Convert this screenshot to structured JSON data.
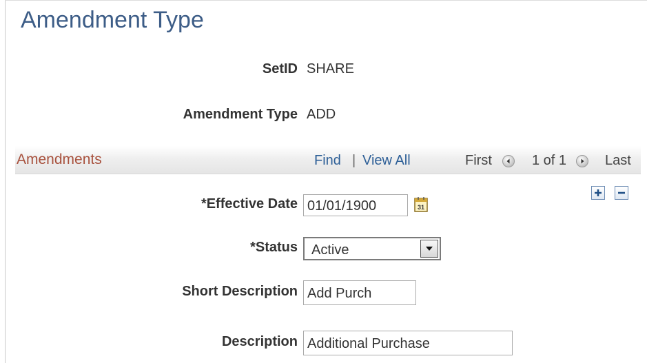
{
  "page": {
    "title": "Amendment Type"
  },
  "header": {
    "setid_label": "SetID",
    "setid_value": "SHARE",
    "amendment_type_label": "Amendment Type",
    "amendment_type_value": "ADD"
  },
  "grid": {
    "title": "Amendments",
    "find_label": "Find",
    "separator": "|",
    "view_all_label": "View All",
    "first_label": "First",
    "range_label": "1 of 1",
    "last_label": "Last"
  },
  "form": {
    "effective_date_label": "*Effective Date",
    "effective_date_value": "01/01/1900",
    "calendar_icon_text": "31",
    "status_label": "*Status",
    "status_value": "Active",
    "short_description_label": "Short Description",
    "short_description_value": "Add Purch",
    "description_label": "Description",
    "description_value": "Additional Purchase"
  },
  "icons": {
    "previous": "chevron-left-icon",
    "next": "chevron-right-icon",
    "add_row": "plus-icon",
    "delete_row": "minus-icon",
    "calendar": "calendar-icon",
    "dropdown": "chevron-down-icon"
  },
  "colors": {
    "title": "#3d5d87",
    "grid_title": "#a8513d",
    "link": "#2d5f97"
  }
}
